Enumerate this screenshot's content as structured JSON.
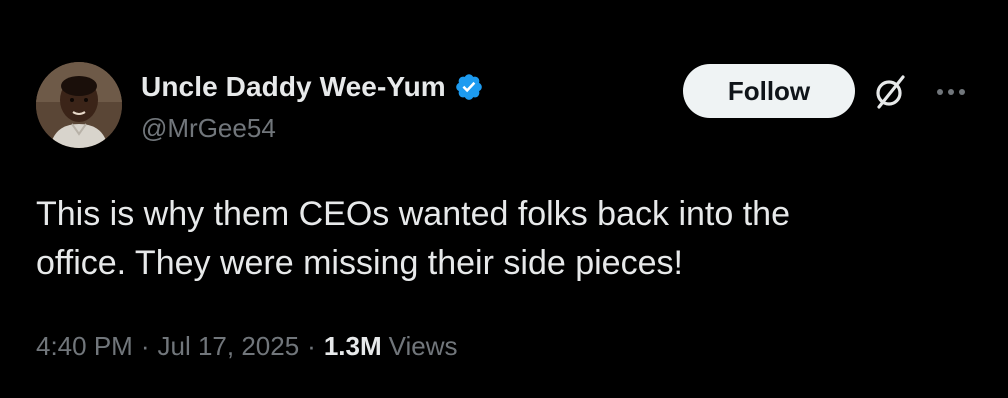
{
  "author": {
    "display_name": "Uncle Daddy Wee-Yum",
    "handle": "@MrGee54",
    "verified": true,
    "verified_icon": "verified-badge-icon",
    "verified_color": "#1d9bf0"
  },
  "actions": {
    "follow_label": "Follow",
    "grok_icon": "grok-slash-icon",
    "more_icon": "more-dots-icon"
  },
  "tweet": {
    "text": "This is why them CEOs wanted folks back into the\noffice. They were missing their side pieces!",
    "time": "4:40 PM",
    "separator": "·",
    "date": "Jul 17, 2025",
    "views_count": "1.3M",
    "views_label": "Views"
  },
  "colors": {
    "background": "#000000",
    "primary_text": "#e7e9ea",
    "secondary_text": "#71767b",
    "follow_button_bg": "#eff3f4",
    "follow_button_text": "#0f1419"
  }
}
